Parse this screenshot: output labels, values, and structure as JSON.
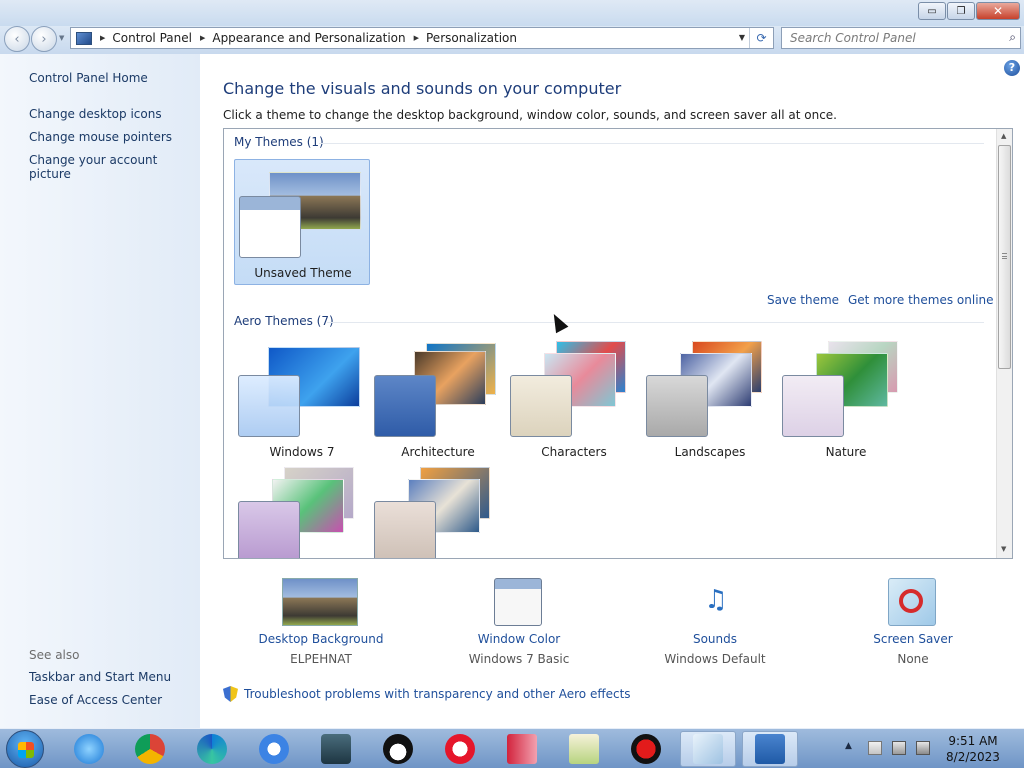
{
  "window": {
    "minimize": "▭",
    "maximize": "❐",
    "close": "✕"
  },
  "nav": {
    "back": "‹",
    "forward": "›",
    "breadcrumbs": [
      "Control Panel",
      "Appearance and Personalization",
      "Personalization"
    ],
    "search_placeholder": "Search Control Panel"
  },
  "sidebar": {
    "home": "Control Panel Home",
    "links": [
      "Change desktop icons",
      "Change mouse pointers",
      "Change your account picture"
    ],
    "see_also_title": "See also",
    "see_also": [
      "Taskbar and Start Menu",
      "Ease of Access Center"
    ]
  },
  "main": {
    "title": "Change the visuals and sounds on your computer",
    "subtitle": "Click a theme to change the desktop background, window color, sounds, and screen saver all at once.",
    "my_themes_header": "My Themes (1)",
    "my_theme_name": "Unsaved Theme",
    "save_theme": "Save theme",
    "get_more": "Get more themes online",
    "aero_header": "Aero Themes (7)",
    "aero_themes": [
      "Windows 7",
      "Architecture",
      "Characters",
      "Landscapes",
      "Nature",
      "",
      ""
    ]
  },
  "bottom": [
    {
      "name": "Desktop Background",
      "value": "ELPEHNAT",
      "icon": "elephant-picture-icon"
    },
    {
      "name": "Window Color",
      "value": "Windows 7 Basic",
      "icon": "window-color-icon"
    },
    {
      "name": "Sounds",
      "value": "Windows Default",
      "icon": "music-notes-icon"
    },
    {
      "name": "Screen Saver",
      "value": "None",
      "icon": "screen-saver-icon"
    }
  ],
  "troubleshoot": "Troubleshoot problems with transparency and other Aero effects",
  "taskbar": {
    "time": "9:51 AM",
    "date": "8/2/2023",
    "apps": [
      "internet-explorer",
      "chrome",
      "edge",
      "chrome-alt",
      "network",
      "linux-penguin",
      "opera",
      "text-tool",
      "chart-tool",
      "record",
      "notepad",
      "control-panel"
    ]
  },
  "colors": {
    "link": "#1f4f9b",
    "title": "#1e3d7a",
    "taskbar": "#6f95c6"
  }
}
